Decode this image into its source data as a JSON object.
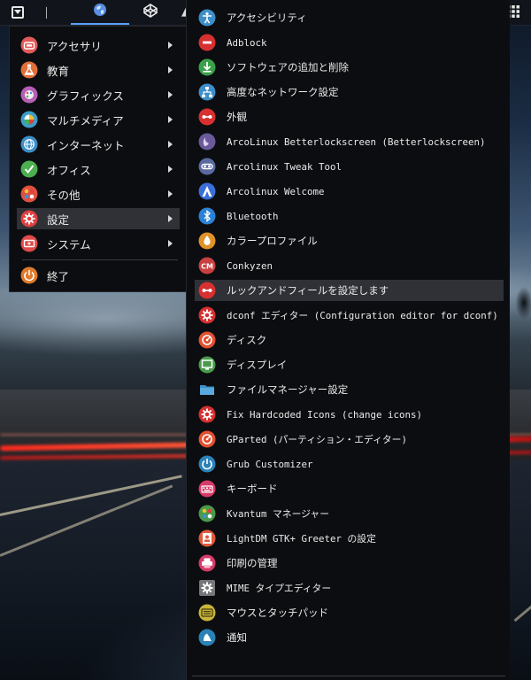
{
  "panel": {
    "menu_icon": "menu-icon",
    "browser_icon": "globe-icon",
    "code_icon": "codepen-icon",
    "grid_icon": "grid-icon"
  },
  "categories": [
    {
      "label": "アクセサリ",
      "icon": "accessories-icon",
      "color": "#e05a5a"
    },
    {
      "label": "教育",
      "icon": "education-icon",
      "color": "#e0703a"
    },
    {
      "label": "グラフィックス",
      "icon": "graphics-icon",
      "color": "#b45fb5"
    },
    {
      "label": "マルチメディア",
      "icon": "multimedia-icon",
      "color": "#3c9ec8"
    },
    {
      "label": "インターネット",
      "icon": "internet-icon",
      "color": "#3c8fc8"
    },
    {
      "label": "オフィス",
      "icon": "office-icon",
      "color": "#4caf50"
    },
    {
      "label": "その他",
      "icon": "other-icon",
      "color": "#e05040"
    },
    {
      "label": "設定",
      "icon": "settings-icon",
      "color": "#e04040"
    },
    {
      "label": "システム",
      "icon": "system-icon",
      "color": "#e04a4a"
    },
    {
      "label": "終了",
      "icon": "logout-icon",
      "color": "#e07a2a"
    }
  ],
  "apps": [
    {
      "label": "アクセシビリティ",
      "mono": false,
      "icon": "accessibility-icon",
      "color": "#3c8fc8"
    },
    {
      "label": "Adblock",
      "mono": true,
      "icon": "adblock-icon",
      "color": "#d63030"
    },
    {
      "label": "ソフトウェアの追加と削除",
      "mono": false,
      "icon": "software-install-icon",
      "color": "#3aa04a"
    },
    {
      "label": "高度なネットワーク設定",
      "mono": false,
      "icon": "network-icon",
      "color": "#3c8fc8"
    },
    {
      "label": "外観",
      "mono": false,
      "icon": "appearance-icon",
      "color": "#d63030"
    },
    {
      "label": "ArcoLinux Betterlockscreen (Betterlockscreen)",
      "mono": true,
      "icon": "lockscreen-icon",
      "color": "#6a5a9a"
    },
    {
      "label": "Arcolinux Tweak Tool",
      "mono": true,
      "icon": "tweak-tool-icon",
      "color": "#5a6aa0"
    },
    {
      "label": "Arcolinux Welcome",
      "mono": true,
      "icon": "welcome-icon",
      "color": "#3a6fd8"
    },
    {
      "label": "Bluetooth",
      "mono": true,
      "icon": "bluetooth-icon",
      "color": "#2a82d8"
    },
    {
      "label": "カラープロファイル",
      "mono": false,
      "icon": "color-profile-icon",
      "color": "#e0922a"
    },
    {
      "label": "Conkyzen",
      "mono": true,
      "icon": "conkyzen-icon",
      "color": "#c84040"
    },
    {
      "label": "ルックアンドフィールを設定します",
      "mono": false,
      "icon": "look-and-feel-icon",
      "color": "#d63030"
    },
    {
      "label": "dconf エディター (Configuration editor for dconf)",
      "mono": true,
      "icon": "dconf-icon",
      "color": "#d63030"
    },
    {
      "label": "ディスク",
      "mono": false,
      "icon": "disk-icon",
      "color": "#e05030"
    },
    {
      "label": "ディスプレイ",
      "mono": false,
      "icon": "display-icon",
      "color": "#4a9a4a"
    },
    {
      "label": "ファイルマネージャー設定",
      "mono": false,
      "icon": "folder-icon",
      "color": "#3c8fc8"
    },
    {
      "label": "Fix Hardcoded Icons (change icons)",
      "mono": true,
      "icon": "fix-icons-icon",
      "color": "#d63030"
    },
    {
      "label": "GParted (パーティション・エディター)",
      "mono": true,
      "icon": "gparted-icon",
      "color": "#e05030"
    },
    {
      "label": "Grub Customizer",
      "mono": true,
      "icon": "grub-icon",
      "color": "#2a82b8"
    },
    {
      "label": "キーボード",
      "mono": false,
      "icon": "keyboard-icon",
      "color": "#d63a6a"
    },
    {
      "label": "Kvantum マネージャー",
      "mono": true,
      "icon": "kvantum-icon",
      "color": "#4a9a4a"
    },
    {
      "label": "LightDM GTK+ Greeter の設定",
      "mono": true,
      "icon": "lightdm-icon",
      "color": "#e05a3a"
    },
    {
      "label": "印刷の管理",
      "mono": false,
      "icon": "printer-icon",
      "color": "#d63a6a"
    },
    {
      "label": "MIME タイプエディター",
      "mono": true,
      "icon": "mime-icon",
      "color": "#777777"
    },
    {
      "label": "マウスとタッチパッド",
      "mono": false,
      "icon": "mouse-icon",
      "color": "#c8b43a"
    },
    {
      "label": "通知",
      "mono": false,
      "icon": "notification-icon",
      "color": "#2a82b8"
    }
  ],
  "active_category_index": 7,
  "highlighted_app_index": 11
}
